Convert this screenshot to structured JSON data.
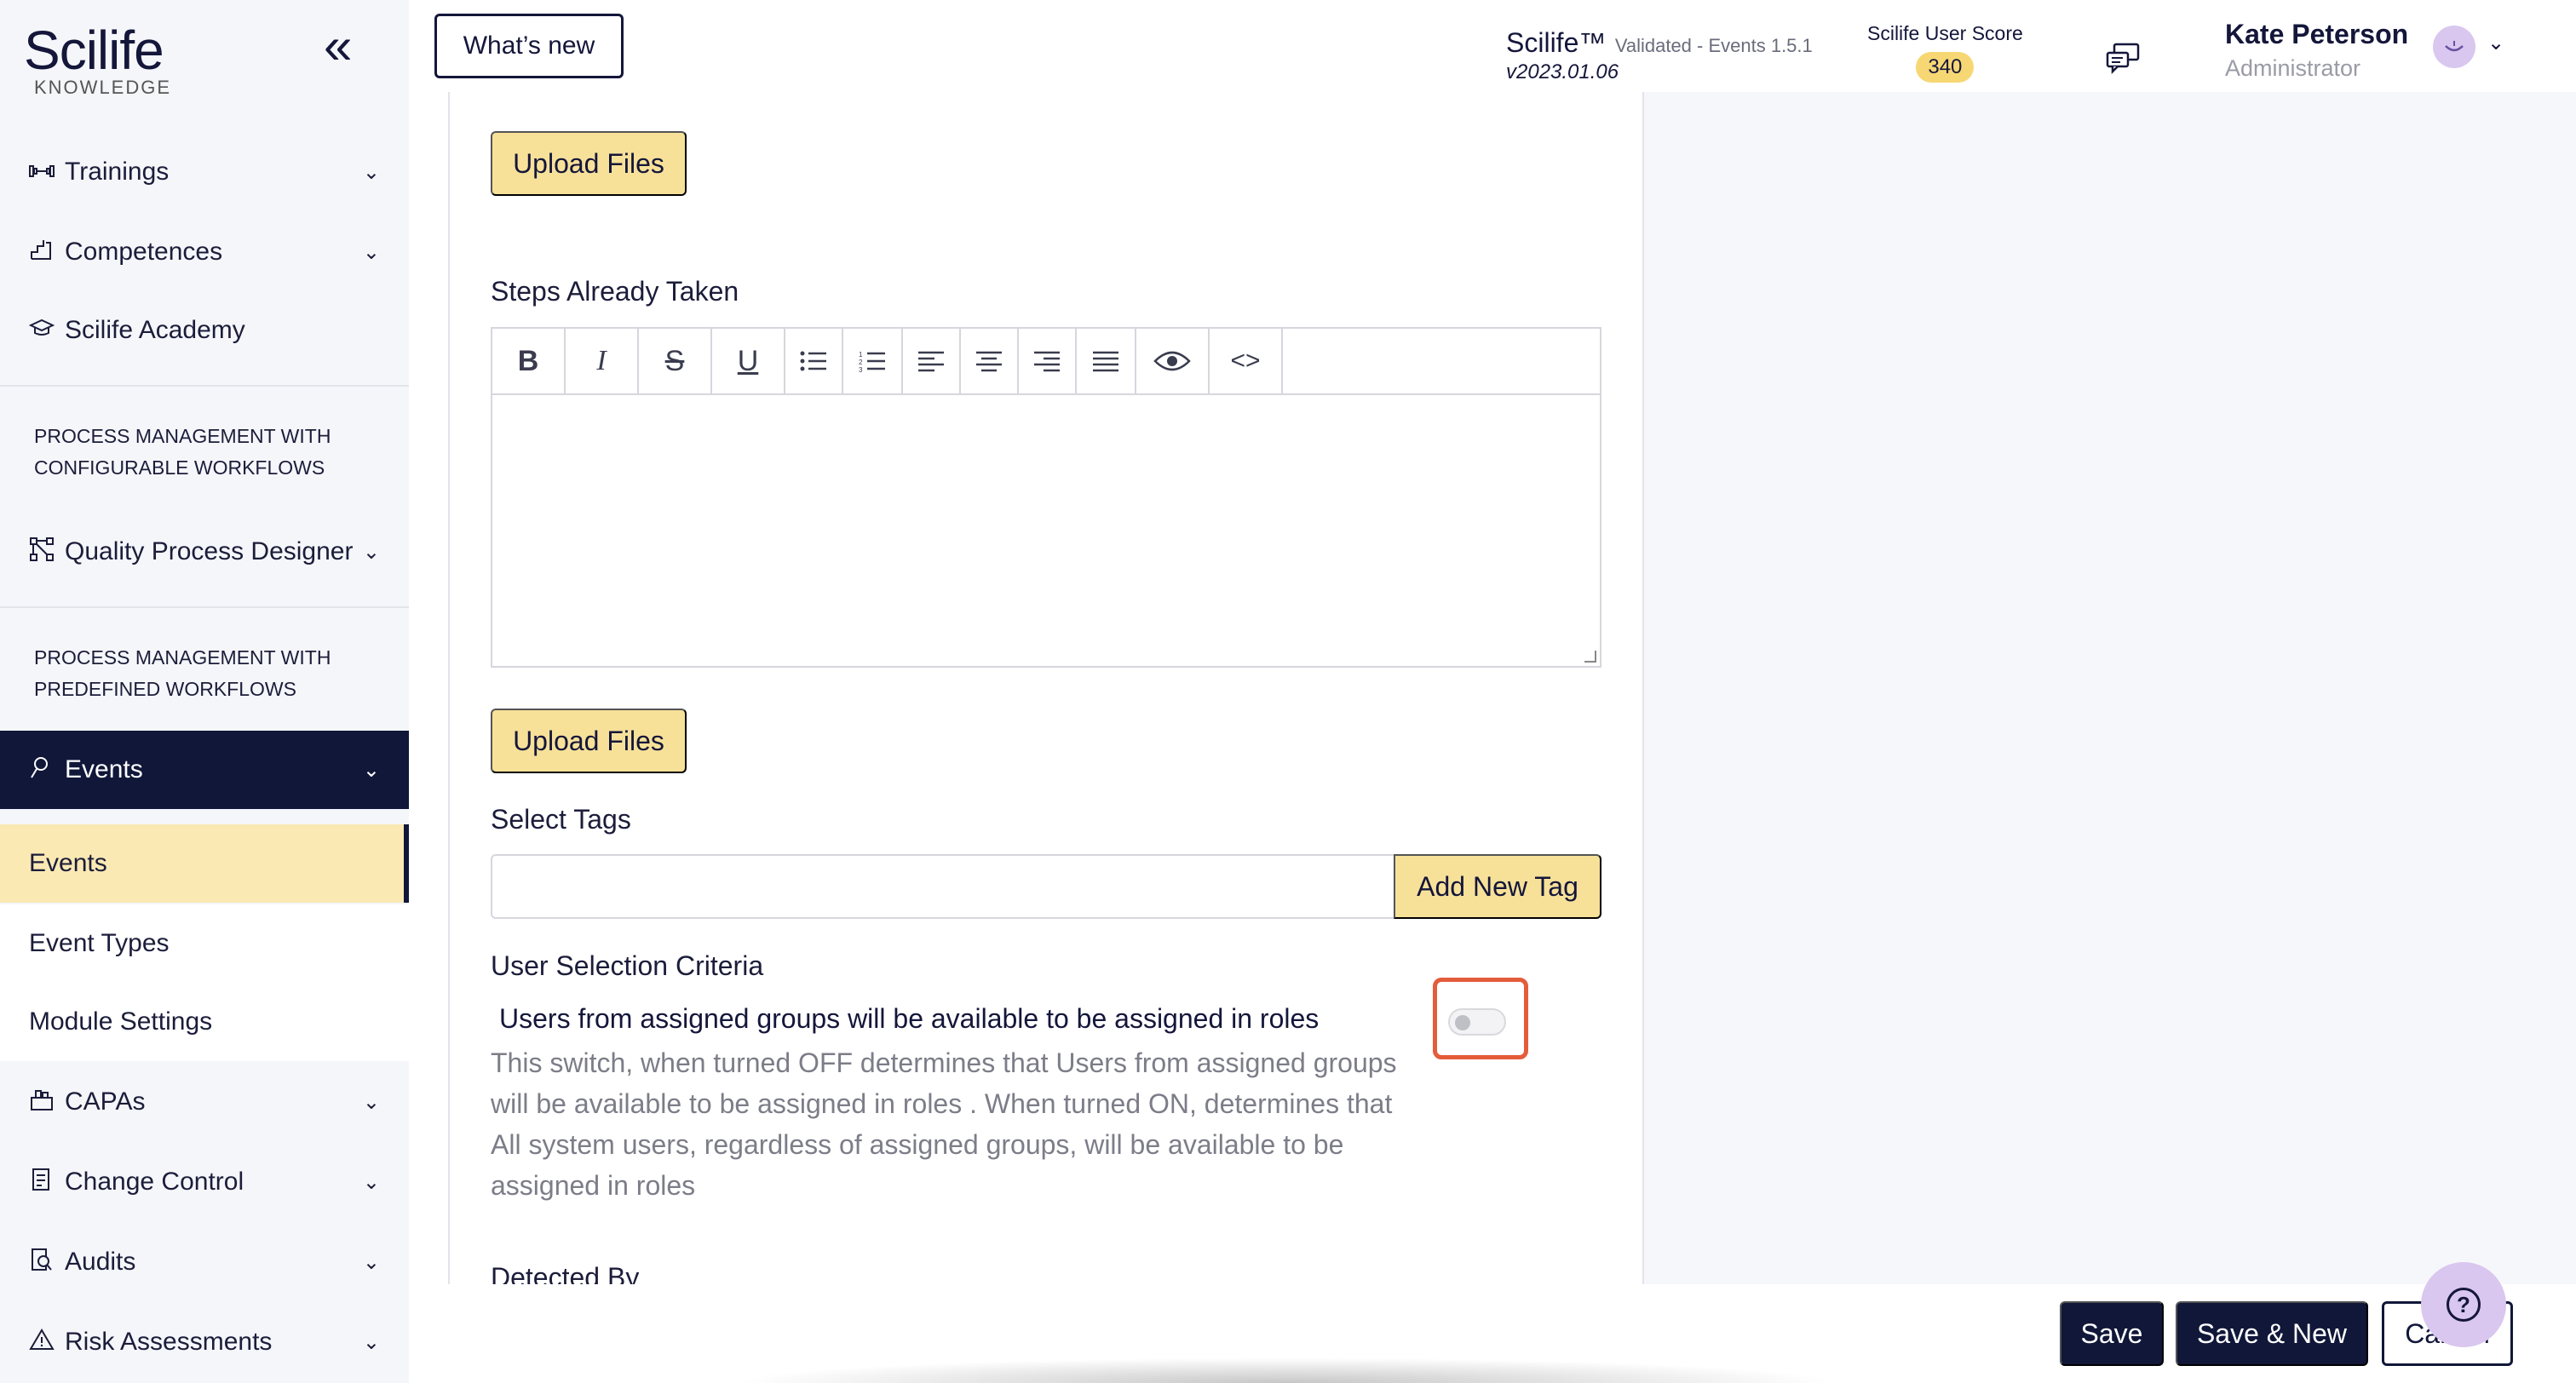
{
  "sidebar": {
    "logo": "Scilife",
    "collapse_icon": "«",
    "cut_section": "KNOWLEDGE",
    "items_top": [
      {
        "label": "Trainings",
        "icon": "dumbbell-icon"
      },
      {
        "label": "Competences",
        "icon": "competences-icon"
      },
      {
        "label": "Scilife Academy",
        "icon": "graduation-cap-icon"
      }
    ],
    "section_configurable": "PROCESS MANAGEMENT WITH CONFIGURABLE WORKFLOWS",
    "quality_designer": "Quality Process Designer",
    "section_predefined": "PROCESS MANAGEMENT WITH PREDEFINED WORKFLOWS",
    "events_group": "Events",
    "events_sub": [
      "Events",
      "Event Types",
      "Module Settings"
    ],
    "items_bottom": [
      {
        "label": "CAPAs",
        "icon": "capa-icon"
      },
      {
        "label": "Change Control",
        "icon": "change-control-icon"
      },
      {
        "label": "Audits",
        "icon": "audits-icon"
      },
      {
        "label": "Risk Assessments",
        "icon": "warning-triangle-icon"
      }
    ]
  },
  "header": {
    "whats_new": "What’s new",
    "brand_name": "Scilife™",
    "brand_meta": "Validated - Events 1.5.1",
    "version": "v2023.01.06",
    "score_label": "Scilife User Score",
    "score_value": "340",
    "user_name": "Kate Peterson",
    "user_role": "Administrator"
  },
  "form": {
    "upload_files_1": "Upload Files",
    "steps_label": "Steps Already Taken",
    "toolbar": {
      "bold": "B",
      "italic": "I",
      "strike": "S",
      "underline": "U",
      "code": "<>"
    },
    "upload_files_2": "Upload Files",
    "tags_label": "Select Tags",
    "tags_input_value": "",
    "add_tag": "Add New Tag",
    "criteria_label": "User Selection Criteria",
    "criteria_title": "Users from assigned groups will be available to be assigned in roles",
    "criteria_desc": "This switch, when turned OFF determines that Users from assigned groups will be available to be assigned in roles . When turned ON, determines that All system users, regardless of assigned groups, will be available to be assigned in roles",
    "toggle_state": "off",
    "detected_by": "Detected By"
  },
  "footer": {
    "save": "Save",
    "save_new": "Save & New",
    "cancel": "Cancel"
  },
  "colors": {
    "navy": "#101739",
    "accent_yellow": "#f7e199",
    "active_bg": "#fbe9b4",
    "highlight": "#e45c3a",
    "avatar": "#d9c7ef"
  }
}
